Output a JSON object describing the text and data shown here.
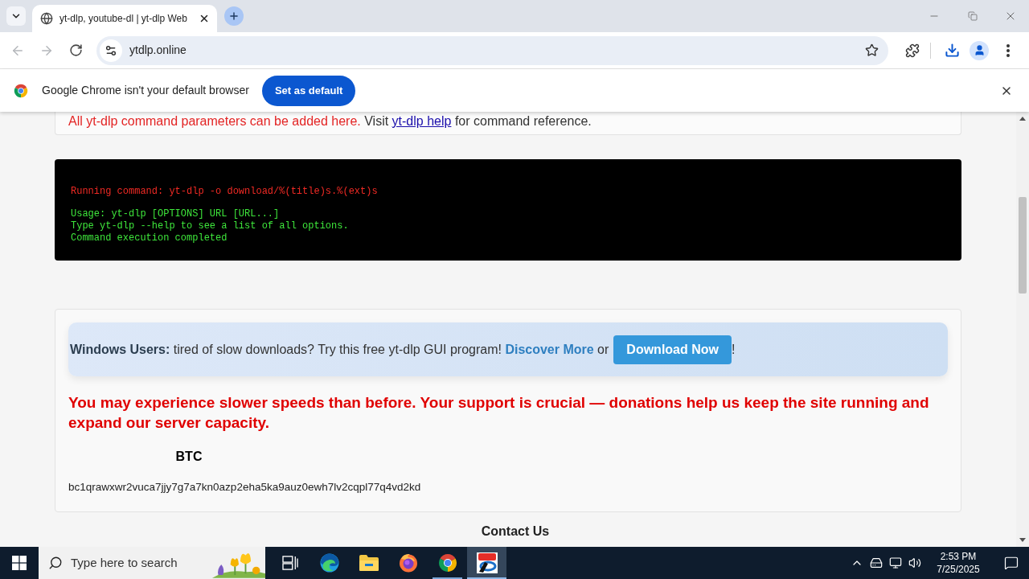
{
  "browser": {
    "tab_title": "yt-dlp, youtube-dl | yt-dlp Web",
    "url": "ytdlp.online",
    "back_disabled": true,
    "forward_disabled": true
  },
  "infobar": {
    "message": "Google Chrome isn't your default browser",
    "button": "Set as default"
  },
  "params_note": {
    "parts": [
      {
        "kind": "warning",
        "text": "All yt-dlp command parameters can be added here."
      },
      {
        "kind": "plain",
        "text": "Visit"
      },
      {
        "kind": "link",
        "text": "yt-dlp help"
      },
      {
        "kind": "plain",
        "text": "for command reference."
      }
    ]
  },
  "terminal": {
    "lines": [
      {
        "kind": "command",
        "text": "Running command: yt-dlp -o download/%(title)s.%(ext)s"
      },
      {
        "kind": "output",
        "text": "Usage: yt-dlp [OPTIONS] URL [URL...]"
      },
      {
        "kind": "output",
        "text": "Type yt-dlp --help to see a list of all options."
      },
      {
        "kind": "output",
        "text": "Command execution completed"
      }
    ]
  },
  "promo": {
    "lead": "Windows Users:",
    "text": "tired of slow downloads? Try this free yt-dlp GUI program!",
    "link": "Discover More",
    "joiner": "or",
    "button": "Download Now",
    "end": "!"
  },
  "notice": "You may experience slower speeds than before. Your support is crucial — donations help us keep the site running and expand our server capacity.",
  "donation": {
    "currency": "BTC",
    "address": "bc1qrawxwr2vuca7jjy7g7a7kn0azp2eha5ka9auz0ewh7lv2cqpl77q4vd2kd"
  },
  "footer": {
    "heading": "Contact Us"
  },
  "taskbar": {
    "search_placeholder": "Type here to search",
    "apps": [
      {
        "kind": "task-view",
        "running": false,
        "selected": false
      },
      {
        "kind": "edge",
        "running": false,
        "selected": false
      },
      {
        "kind": "explorer",
        "running": false,
        "selected": false
      },
      {
        "kind": "firefox",
        "running": false,
        "selected": false
      },
      {
        "kind": "chrome",
        "running": true,
        "selected": false
      },
      {
        "kind": "video-app",
        "running": true,
        "selected": true
      }
    ],
    "time": "2:53 PM",
    "date": "7/25/2025"
  }
}
